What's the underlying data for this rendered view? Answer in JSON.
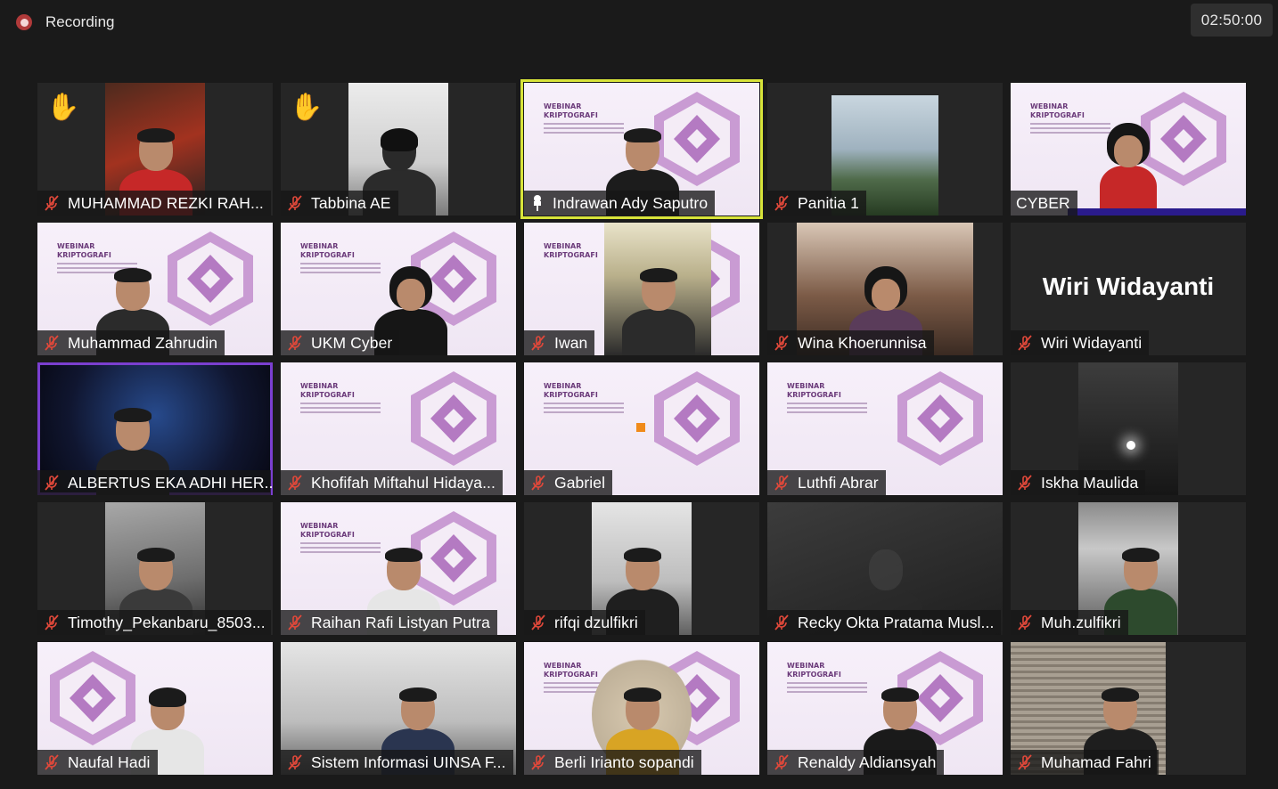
{
  "recording": {
    "label": "Recording"
  },
  "timer": {
    "value": "02:50:00"
  },
  "participants": [
    {
      "name": "MUHAMMAD REZKI RAH...",
      "hand": "✋"
    },
    {
      "name": "Tabbina AE",
      "hand": "✋"
    },
    {
      "name": "Indrawan Ady Saputro"
    },
    {
      "name": "Panitia 1"
    },
    {
      "name": "CYBER"
    },
    {
      "name": "Muhammad Zahrudin"
    },
    {
      "name": "UKM Cyber"
    },
    {
      "name": "Iwan"
    },
    {
      "name": "Wina Khoerunnisa"
    },
    {
      "name": "Wiri Widayanti",
      "display_name": "Wiri Widayanti"
    },
    {
      "name": "ALBERTUS EKA ADHI HER..."
    },
    {
      "name": "Khofifah Miftahul Hidaya..."
    },
    {
      "name": "Gabriel"
    },
    {
      "name": "Luthfi Abrar"
    },
    {
      "name": "Iskha Maulida"
    },
    {
      "name": "Timothy_Pekanbaru_8503..."
    },
    {
      "name": "Raihan Rafi Listyan Putra"
    },
    {
      "name": "rifqi dzulfikri"
    },
    {
      "name": "Recky Okta Pratama Musl..."
    },
    {
      "name": "Muh.zulfikri"
    },
    {
      "name": "Naufal Hadi"
    },
    {
      "name": "Sistem Informasi UINSA F..."
    },
    {
      "name": "Berli Irianto sopandi"
    },
    {
      "name": "Renaldy Aldiansyah"
    },
    {
      "name": "Muhamad Fahri"
    }
  ],
  "poster": {
    "title": "WEBINAR\nKRIPTOGRAFI"
  },
  "colors": {
    "active_speaker_border": "#d8e43a",
    "muted_icon": "#e0483a",
    "recording_dot": "#b03a3a"
  },
  "icons": {
    "muted": "mic-muted-icon",
    "pinned": "pin-icon",
    "recording": "record-icon"
  }
}
